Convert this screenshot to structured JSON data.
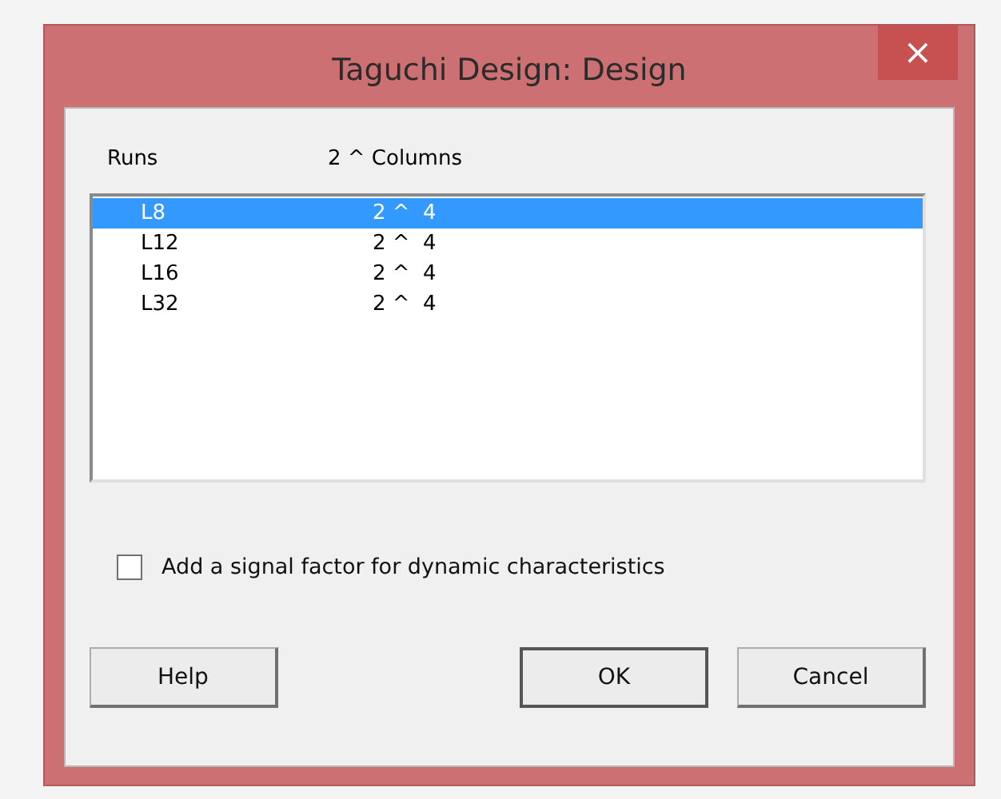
{
  "window": {
    "title": "Taguchi Design: Design",
    "close": "×"
  },
  "columns": [
    "Runs",
    "2 ^ Columns"
  ],
  "rows": [
    {
      "runs": "L8",
      "columns": "2 ^  4",
      "selected": true
    },
    {
      "runs": "L12",
      "columns": "2 ^  4",
      "selected": false
    },
    {
      "runs": "L16",
      "columns": "2 ^  4",
      "selected": false
    },
    {
      "runs": "L32",
      "columns": "2 ^  4",
      "selected": false
    }
  ],
  "checkbox": {
    "label": "Add a signal factor for dynamic characteristics",
    "checked": false
  },
  "buttons": [
    "Help",
    "OK",
    "Cancel"
  ]
}
